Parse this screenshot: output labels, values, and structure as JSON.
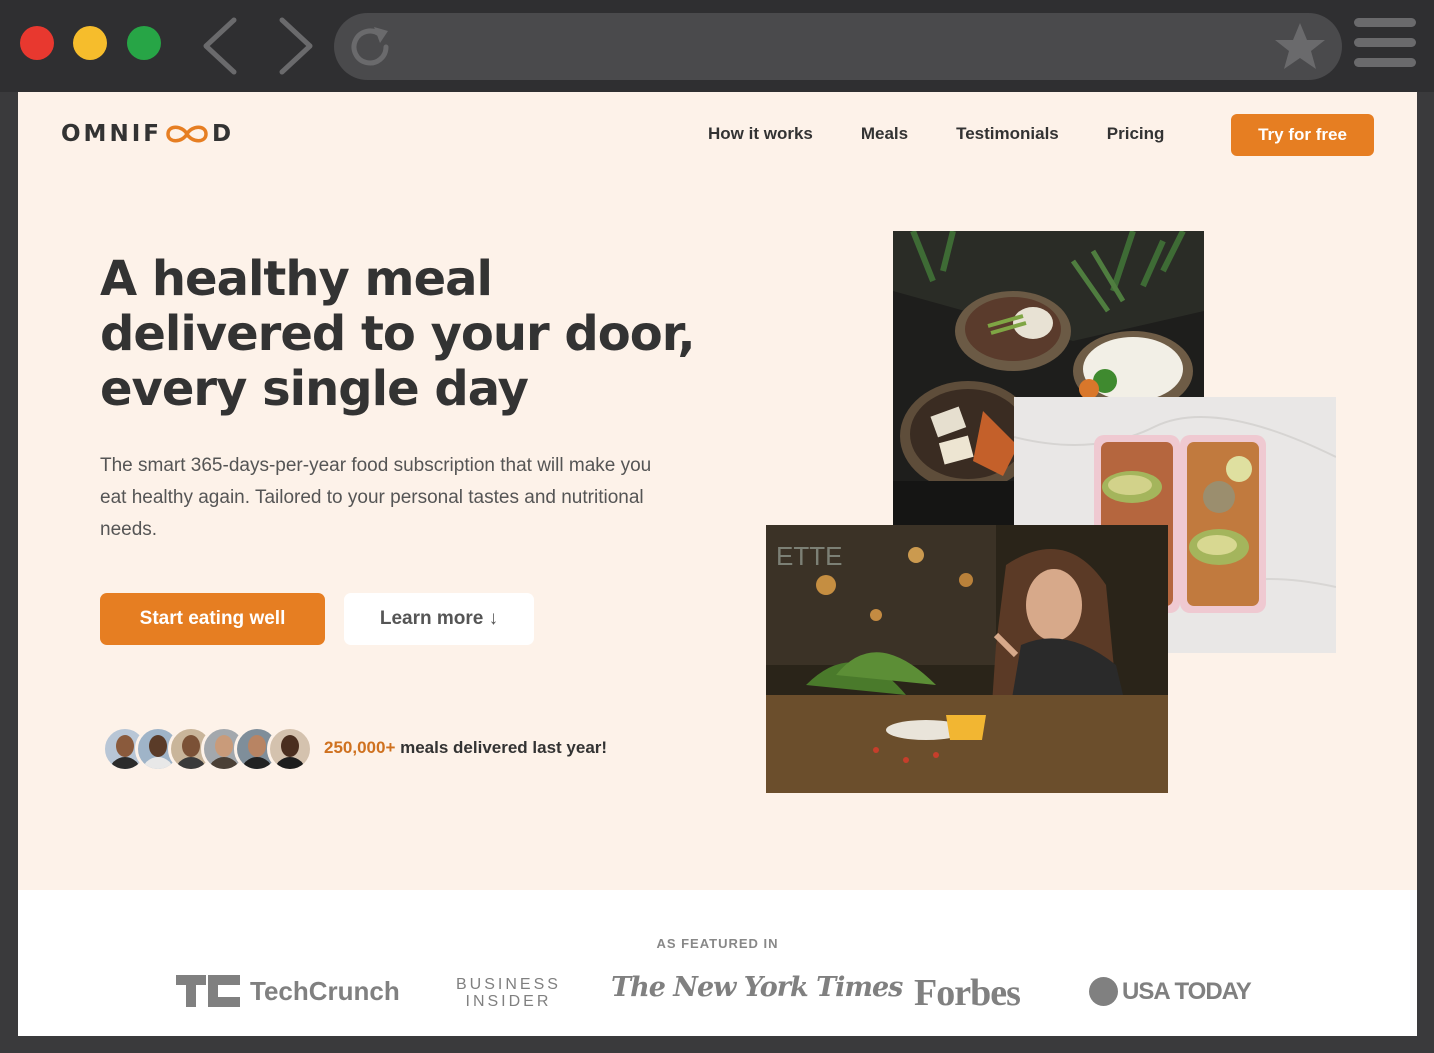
{
  "colors": {
    "brand": "#e67e22",
    "brand_dark": "#cf711f",
    "hero_bg": "#fdf2e9",
    "text": "#333333",
    "chrome_bg": "#2f2f31"
  },
  "browser": {
    "back_icon": "chevron-left-icon",
    "forward_icon": "chevron-right-icon",
    "reload_icon": "reload-icon",
    "bookmark_icon": "star-icon",
    "menu_icon": "hamburger-menu-icon",
    "url": ""
  },
  "header": {
    "logo_text_left": "OMNIF",
    "logo_text_right": "D",
    "nav": [
      {
        "label": "How it works"
      },
      {
        "label": "Meals"
      },
      {
        "label": "Testimonials"
      },
      {
        "label": "Pricing"
      }
    ],
    "cta": "Try for free"
  },
  "hero": {
    "title_lines": [
      "A healthy meal",
      "delivered to your door,",
      "every single day"
    ],
    "description": "The smart 365-days-per-year food subscription that will make you eat healthy again. Tailored to your personal tastes and nutritional needs.",
    "primary_button": "Start eating well",
    "secondary_button": "Learn more ↓",
    "delivered_count": "250,000+",
    "delivered_text": " meals delivered last year!"
  },
  "featured": {
    "title": "AS FEATURED IN",
    "logos": {
      "techcrunch": "TechCrunch",
      "business_insider_line1": "BUSINESS",
      "business_insider_line2": "INSIDER",
      "nyt": "The New York Times",
      "forbes": "Forbes",
      "usatoday": "USA TODAY"
    }
  }
}
